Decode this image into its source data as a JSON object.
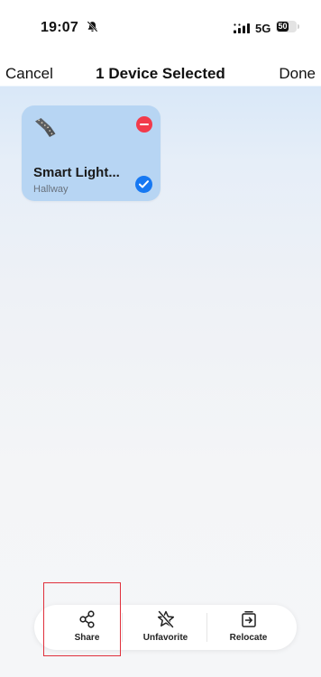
{
  "status_bar": {
    "time": "19:07",
    "bell_icon": "bell-slash-icon",
    "signal_icon": "signal-icon",
    "network": "5G",
    "battery_level": "50"
  },
  "nav": {
    "cancel_label": "Cancel",
    "title": "1 Device Selected",
    "done_label": "Done"
  },
  "device_card": {
    "icon": "light-strip-icon",
    "name": "Smart Light...",
    "room": "Hallway",
    "selected": true
  },
  "action_bar": {
    "items": [
      {
        "label": "Share",
        "icon": "share-icon"
      },
      {
        "label": "Unfavorite",
        "icon": "star-slash-icon"
      },
      {
        "label": "Relocate",
        "icon": "relocate-icon"
      }
    ]
  },
  "colors": {
    "card_background": "#b7d5f3",
    "remove_badge": "#f23a4b",
    "check_badge": "#1678f2",
    "highlight_box": "#e0303c"
  }
}
